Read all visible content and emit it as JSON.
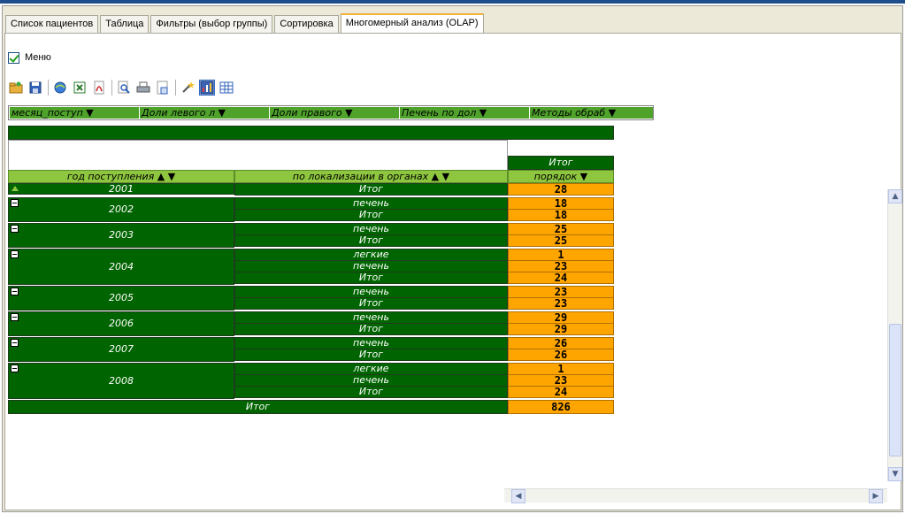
{
  "tabs": [
    {
      "label": "Список пациентов",
      "active": false
    },
    {
      "label": "Таблица",
      "active": false
    },
    {
      "label": "Фильтры (выбор группы)",
      "active": false
    },
    {
      "label": "Сортировка",
      "active": false
    },
    {
      "label": "Многомерный анализ (OLAP)",
      "active": true
    }
  ],
  "menu": {
    "label": "Меню",
    "checked": true
  },
  "toolbar": {
    "icons": [
      "open-folder-icon",
      "save-icon",
      "web-export-icon",
      "excel-export-icon",
      "pdf-export-icon",
      "preview-icon",
      "print-icon",
      "page-setup-icon",
      "wizard-icon",
      "chart-icon",
      "grid-icon"
    ]
  },
  "filters": [
    {
      "label": "месяц_поступ ▼"
    },
    {
      "label": "Доли левого л ▼"
    },
    {
      "label": "Доли правого ▼"
    },
    {
      "label": "Печень по дол ▼"
    },
    {
      "label": "Методы обраб ▼"
    }
  ],
  "pivot": {
    "column_total_header": "Итог",
    "row_headers": [
      {
        "label": "год поступления",
        "sort_icon": "sort-asc-icon",
        "dropdown": "▼"
      },
      {
        "label": "по локализации в органах",
        "sort_icon": "sort-asc-icon",
        "dropdown": "▼"
      }
    ],
    "measure_header": {
      "label": "порядок",
      "dropdown": "▼"
    },
    "groups": [
      {
        "year": "2001",
        "collapsed": true,
        "rows": [
          {
            "organ": "Итог",
            "value": "28"
          }
        ]
      },
      {
        "year": "2002",
        "collapsed": false,
        "rows": [
          {
            "organ": "печень",
            "value": "18"
          },
          {
            "organ": "Итог",
            "value": "18"
          }
        ]
      },
      {
        "year": "2003",
        "collapsed": false,
        "rows": [
          {
            "organ": "печень",
            "value": "25"
          },
          {
            "organ": "Итог",
            "value": "25"
          }
        ]
      },
      {
        "year": "2004",
        "collapsed": false,
        "rows": [
          {
            "organ": "легкие",
            "value": "1"
          },
          {
            "organ": "печень",
            "value": "23"
          },
          {
            "organ": "Итог",
            "value": "24"
          }
        ]
      },
      {
        "year": "2005",
        "collapsed": false,
        "rows": [
          {
            "organ": "печень",
            "value": "23"
          },
          {
            "organ": "Итог",
            "value": "23"
          }
        ]
      },
      {
        "year": "2006",
        "collapsed": false,
        "rows": [
          {
            "organ": "печень",
            "value": "29"
          },
          {
            "organ": "Итог",
            "value": "29"
          }
        ]
      },
      {
        "year": "2007",
        "collapsed": false,
        "rows": [
          {
            "organ": "печень",
            "value": "26"
          },
          {
            "organ": "Итог",
            "value": "26"
          }
        ]
      },
      {
        "year": "2008",
        "collapsed": false,
        "rows": [
          {
            "organ": "легкие",
            "value": "1"
          },
          {
            "organ": "печень",
            "value": "23"
          },
          {
            "organ": "Итог",
            "value": "24"
          }
        ]
      }
    ],
    "grand_total": {
      "label": "Итог",
      "value": "826"
    }
  },
  "colors": {
    "cell_green": "#006400",
    "header_green": "#8ec63f",
    "value_orange": "#ffa500",
    "active_tab_accent": "#f2b33d"
  }
}
